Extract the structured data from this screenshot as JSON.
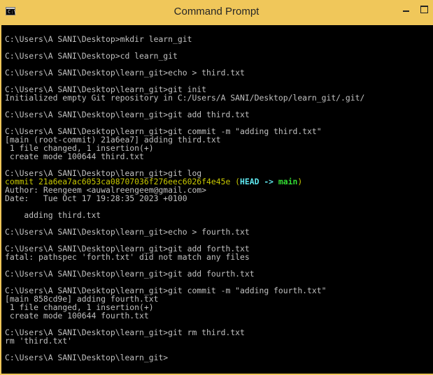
{
  "window": {
    "title": "Command Prompt",
    "icon": "cmd-icon",
    "minimize_label": "▁",
    "maximize_label": "□"
  },
  "console": {
    "lines": [
      [
        {
          "text": "",
          "color": "default"
        }
      ],
      [
        {
          "text": "C:\\Users\\A SANI\\Desktop>mkdir learn_git",
          "color": "default"
        }
      ],
      [
        {
          "text": "",
          "color": "default"
        }
      ],
      [
        {
          "text": "C:\\Users\\A SANI\\Desktop>cd learn_git",
          "color": "default"
        }
      ],
      [
        {
          "text": "",
          "color": "default"
        }
      ],
      [
        {
          "text": "C:\\Users\\A SANI\\Desktop\\learn_git>echo > third.txt",
          "color": "default"
        }
      ],
      [
        {
          "text": "",
          "color": "default"
        }
      ],
      [
        {
          "text": "C:\\Users\\A SANI\\Desktop\\learn_git>git init",
          "color": "default"
        }
      ],
      [
        {
          "text": "Initialized empty Git repository in C:/Users/A SANI/Desktop/learn_git/.git/",
          "color": "default"
        }
      ],
      [
        {
          "text": "",
          "color": "default"
        }
      ],
      [
        {
          "text": "C:\\Users\\A SANI\\Desktop\\learn_git>git add third.txt",
          "color": "default"
        }
      ],
      [
        {
          "text": "",
          "color": "default"
        }
      ],
      [
        {
          "text": "C:\\Users\\A SANI\\Desktop\\learn_git>git commit -m \"adding third.txt\"",
          "color": "default"
        }
      ],
      [
        {
          "text": "[main (root-commit) 21a6ea7] adding third.txt",
          "color": "default"
        }
      ],
      [
        {
          "text": " 1 file changed, 1 insertion(+)",
          "color": "default"
        }
      ],
      [
        {
          "text": " create mode 100644 third.txt",
          "color": "default"
        }
      ],
      [
        {
          "text": "",
          "color": "default"
        }
      ],
      [
        {
          "text": "C:\\Users\\A SANI\\Desktop\\learn_git>git log",
          "color": "default"
        }
      ],
      [
        {
          "text": "commit 21a6ea7ac6053ca08707036f276eec6026f4e45e (",
          "color": "yellow"
        },
        {
          "text": "HEAD -> ",
          "color": "cyan"
        },
        {
          "text": "main",
          "color": "green"
        },
        {
          "text": ")",
          "color": "yellow"
        }
      ],
      [
        {
          "text": "Author: Reengeem <auwalreengeem@gmail.com>",
          "color": "default"
        }
      ],
      [
        {
          "text": "Date:   Tue Oct 17 19:28:35 2023 +0100",
          "color": "default"
        }
      ],
      [
        {
          "text": "",
          "color": "default"
        }
      ],
      [
        {
          "text": "    adding third.txt",
          "color": "default"
        }
      ],
      [
        {
          "text": "",
          "color": "default"
        }
      ],
      [
        {
          "text": "C:\\Users\\A SANI\\Desktop\\learn_git>echo > fourth.txt",
          "color": "default"
        }
      ],
      [
        {
          "text": "",
          "color": "default"
        }
      ],
      [
        {
          "text": "C:\\Users\\A SANI\\Desktop\\learn_git>git add forth.txt",
          "color": "default"
        }
      ],
      [
        {
          "text": "fatal: pathspec 'forth.txt' did not match any files",
          "color": "default"
        }
      ],
      [
        {
          "text": "",
          "color": "default"
        }
      ],
      [
        {
          "text": "C:\\Users\\A SANI\\Desktop\\learn_git>git add fourth.txt",
          "color": "default"
        }
      ],
      [
        {
          "text": "",
          "color": "default"
        }
      ],
      [
        {
          "text": "C:\\Users\\A SANI\\Desktop\\learn_git>git commit -m \"adding fourth.txt\"",
          "color": "default"
        }
      ],
      [
        {
          "text": "[main 858cd9e] adding fourth.txt",
          "color": "default"
        }
      ],
      [
        {
          "text": " 1 file changed, 1 insertion(+)",
          "color": "default"
        }
      ],
      [
        {
          "text": " create mode 100644 fourth.txt",
          "color": "default"
        }
      ],
      [
        {
          "text": "",
          "color": "default"
        }
      ],
      [
        {
          "text": "C:\\Users\\A SANI\\Desktop\\learn_git>git rm third.txt",
          "color": "default"
        }
      ],
      [
        {
          "text": "rm 'third.txt'",
          "color": "default"
        }
      ],
      [
        {
          "text": "",
          "color": "default"
        }
      ],
      [
        {
          "text": "C:\\Users\\A SANI\\Desktop\\learn_git>",
          "color": "default"
        }
      ]
    ]
  },
  "colors": {
    "titlebar": "#f0c75a",
    "console_bg": "#000000",
    "console_text": "#c0c0c0",
    "commit_hash": "#c8c800",
    "head_ref": "#5fe8f0",
    "branch_ref": "#33dd33"
  }
}
